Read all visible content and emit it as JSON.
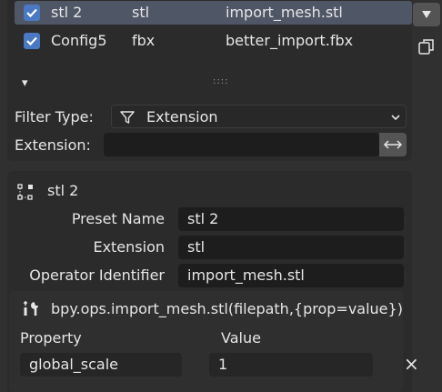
{
  "list": {
    "rows": [
      {
        "name": "stl 2",
        "ext": "stl",
        "op": "import_mesh.stl",
        "selected": true
      },
      {
        "name": "Config5",
        "ext": "fbx",
        "op": "better_import.fbx",
        "selected": false
      }
    ],
    "expand_glyph": "▾",
    "resize_glyph": "::::"
  },
  "filter": {
    "type_label": "Filter Type:",
    "type_value": "Extension",
    "ext_label": "Extension:",
    "ext_value": ""
  },
  "detail": {
    "title": "stl 2",
    "fields": [
      {
        "label": "Preset Name",
        "value": "stl 2"
      },
      {
        "label": "Extension",
        "value": "stl"
      },
      {
        "label": "Operator Identifier",
        "value": "import_mesh.stl"
      }
    ],
    "operator_call": "bpy.ops.import_mesh.stl(filepath,{prop=value})",
    "prop_header": "Property",
    "value_header": "Value",
    "props": [
      {
        "property": "global_scale",
        "value": "1"
      }
    ],
    "remove_glyph": "×"
  },
  "colors": {
    "accent": "#4a78c2",
    "selected_row": "#4f5766"
  }
}
